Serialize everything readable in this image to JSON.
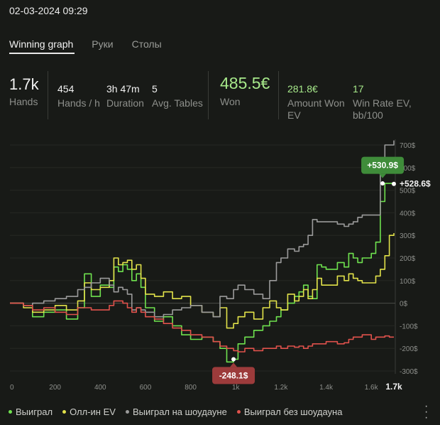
{
  "datetime": "02-03-2024 09:29",
  "tabs": [
    {
      "label": "Winning graph",
      "active": true
    },
    {
      "label": "Руки",
      "active": false
    },
    {
      "label": "Столы",
      "active": false
    }
  ],
  "stats": {
    "hands": {
      "value": "1.7k",
      "label": "Hands"
    },
    "hands_per_hour": {
      "value": "454",
      "label": "Hands / h"
    },
    "duration": {
      "value": "3h 47m",
      "label": "Duration"
    },
    "avg_tables": {
      "value": "5",
      "label": "Avg. Tables"
    },
    "won": {
      "value": "485.5€",
      "label": "Won"
    },
    "amount_won_ev": {
      "value": "281.8€",
      "label_line1": "Amount Won",
      "label_line2": "EV"
    },
    "win_rate_ev": {
      "value": "17",
      "label_line1": "Win Rate EV,",
      "label_line2": "bb/100"
    }
  },
  "colors": {
    "green": "#6fe24f",
    "yellow": "#e2e24a",
    "gray": "#9b9b9b",
    "red": "#e0524c",
    "accent_value": "#a6e88a",
    "badge_green": "#3f8c3a",
    "badge_red": "#9c3b3b"
  },
  "chart_data": {
    "type": "line",
    "xlim": [
      0,
      1700
    ],
    "ylim": [
      -300,
      700
    ],
    "x_ticks": [
      {
        "v": 0,
        "label": "0"
      },
      {
        "v": 200,
        "label": "200"
      },
      {
        "v": 400,
        "label": "400"
      },
      {
        "v": 600,
        "label": "600"
      },
      {
        "v": 800,
        "label": "800"
      },
      {
        "v": 1000,
        "label": "1k"
      },
      {
        "v": 1200,
        "label": "1.2k"
      },
      {
        "v": 1400,
        "label": "1.4k"
      },
      {
        "v": 1600,
        "label": "1.6k"
      }
    ],
    "x_end_label": "1.7k",
    "y_ticks": [
      {
        "v": 700,
        "label": "700$"
      },
      {
        "v": 600,
        "label": "600$"
      },
      {
        "v": 500,
        "label": "500$"
      },
      {
        "v": 400,
        "label": "400$"
      },
      {
        "v": 300,
        "label": "300$"
      },
      {
        "v": 200,
        "label": "200$"
      },
      {
        "v": 100,
        "label": "100$"
      },
      {
        "v": 0,
        "label": "0$"
      },
      {
        "v": -100,
        "label": "-100$"
      },
      {
        "v": -200,
        "label": "-200$"
      },
      {
        "v": -300,
        "label": "-300$"
      }
    ],
    "series": [
      {
        "name": "Выиграл",
        "color": "#6fe24f",
        "x": [
          0,
          60,
          100,
          150,
          200,
          250,
          300,
          330,
          360,
          400,
          440,
          460,
          480,
          500,
          520,
          540,
          560,
          580,
          600,
          640,
          680,
          720,
          760,
          800,
          850,
          900,
          930,
          960,
          990,
          1010,
          1040,
          1080,
          1120,
          1150,
          1180,
          1200,
          1230,
          1260,
          1280,
          1300,
          1320,
          1340,
          1360,
          1380,
          1400,
          1450,
          1480,
          1500,
          1520,
          1540,
          1560,
          1600,
          1620,
          1640,
          1660,
          1680,
          1700
        ],
        "y": [
          0,
          -10,
          -60,
          -40,
          -30,
          -70,
          -20,
          130,
          30,
          80,
          70,
          160,
          140,
          170,
          150,
          100,
          130,
          70,
          -20,
          -80,
          -60,
          -100,
          -140,
          -160,
          -150,
          -170,
          -200,
          -260,
          -248,
          -180,
          -150,
          -120,
          -100,
          -80,
          -60,
          -30,
          0,
          30,
          50,
          80,
          30,
          20,
          170,
          160,
          150,
          180,
          160,
          220,
          200,
          180,
          200,
          220,
          270,
          450,
          530,
          530,
          528
        ]
      },
      {
        "name": "Олл-ин EV",
        "color": "#e2e24a",
        "x": [
          0,
          60,
          100,
          150,
          200,
          250,
          300,
          330,
          360,
          400,
          440,
          460,
          480,
          500,
          520,
          540,
          560,
          580,
          600,
          640,
          680,
          720,
          760,
          800,
          850,
          900,
          930,
          960,
          990,
          1010,
          1040,
          1080,
          1120,
          1150,
          1180,
          1200,
          1230,
          1260,
          1280,
          1300,
          1320,
          1340,
          1360,
          1380,
          1400,
          1450,
          1480,
          1500,
          1520,
          1540,
          1560,
          1600,
          1620,
          1640,
          1660,
          1680,
          1700
        ],
        "y": [
          0,
          -20,
          -40,
          -30,
          -10,
          -30,
          10,
          90,
          60,
          70,
          100,
          200,
          170,
          180,
          190,
          150,
          170,
          110,
          40,
          30,
          50,
          20,
          30,
          -10,
          -40,
          -60,
          -20,
          -110,
          -90,
          -60,
          -40,
          -70,
          -20,
          10,
          -20,
          -30,
          40,
          10,
          30,
          60,
          20,
          60,
          110,
          80,
          80,
          120,
          100,
          130,
          110,
          100,
          90,
          90,
          120,
          150,
          210,
          300,
          310
        ]
      },
      {
        "name": "Выиграл на шоудауне",
        "color": "#9b9b9b",
        "x": [
          0,
          60,
          100,
          150,
          200,
          250,
          300,
          330,
          360,
          400,
          440,
          460,
          480,
          500,
          520,
          540,
          560,
          580,
          600,
          640,
          680,
          720,
          760,
          800,
          850,
          900,
          930,
          960,
          990,
          1010,
          1040,
          1080,
          1120,
          1150,
          1180,
          1200,
          1230,
          1260,
          1280,
          1300,
          1320,
          1340,
          1360,
          1380,
          1400,
          1450,
          1480,
          1500,
          1520,
          1540,
          1560,
          1600,
          1620,
          1640,
          1660,
          1680,
          1700
        ],
        "y": [
          0,
          -10,
          0,
          10,
          20,
          30,
          60,
          70,
          90,
          110,
          80,
          50,
          70,
          60,
          40,
          -30,
          -20,
          -30,
          -40,
          -60,
          -50,
          -30,
          -20,
          -10,
          -40,
          -60,
          30,
          20,
          60,
          80,
          60,
          40,
          20,
          100,
          180,
          200,
          240,
          230,
          250,
          260,
          300,
          370,
          360,
          360,
          360,
          350,
          340,
          350,
          360,
          380,
          390,
          390,
          390,
          600,
          700,
          700,
          720
        ]
      },
      {
        "name": "Выиграл без шоудауна",
        "color": "#e0524c",
        "x": [
          0,
          60,
          100,
          150,
          200,
          250,
          300,
          330,
          360,
          400,
          440,
          460,
          480,
          500,
          520,
          540,
          560,
          580,
          600,
          640,
          680,
          720,
          760,
          800,
          850,
          900,
          930,
          960,
          990,
          1010,
          1040,
          1080,
          1120,
          1150,
          1180,
          1200,
          1230,
          1260,
          1280,
          1300,
          1320,
          1340,
          1360,
          1380,
          1400,
          1450,
          1480,
          1500,
          1520,
          1540,
          1560,
          1600,
          1620,
          1640,
          1660,
          1680,
          1700
        ],
        "y": [
          0,
          -10,
          -30,
          -20,
          -40,
          -50,
          -20,
          -20,
          -30,
          -30,
          -10,
          10,
          10,
          0,
          -20,
          -40,
          -20,
          -40,
          -60,
          -70,
          -90,
          -110,
          -120,
          -140,
          -150,
          -170,
          -190,
          -200,
          -210,
          -215,
          -200,
          -210,
          -200,
          -200,
          -190,
          -200,
          -190,
          -195,
          -190,
          -200,
          -190,
          -180,
          -180,
          -180,
          -170,
          -180,
          -175,
          -160,
          -150,
          -150,
          -140,
          -160,
          -150,
          -150,
          -145,
          -150,
          -150
        ]
      }
    ],
    "annotations": [
      {
        "text": "+530.9$",
        "x": 1650,
        "y": 530,
        "style": "badge-green",
        "badge_y": 610
      },
      {
        "text": "+528.6$",
        "x": 1700,
        "y": 528,
        "style": "label"
      },
      {
        "text": "-248.1$",
        "x": 990,
        "y": -248,
        "style": "badge-red",
        "badge_y": -320
      }
    ]
  },
  "legend": [
    {
      "label": "Выиграл",
      "color": "#6fe24f"
    },
    {
      "label": "Олл-ин EV",
      "color": "#e2e24a"
    },
    {
      "label": "Выиграл на шоудауне",
      "color": "#9b9b9b"
    },
    {
      "label": "Выиграл без шоудауна",
      "color": "#e0524c"
    }
  ],
  "menu_icon": "vertical-dots-icon"
}
